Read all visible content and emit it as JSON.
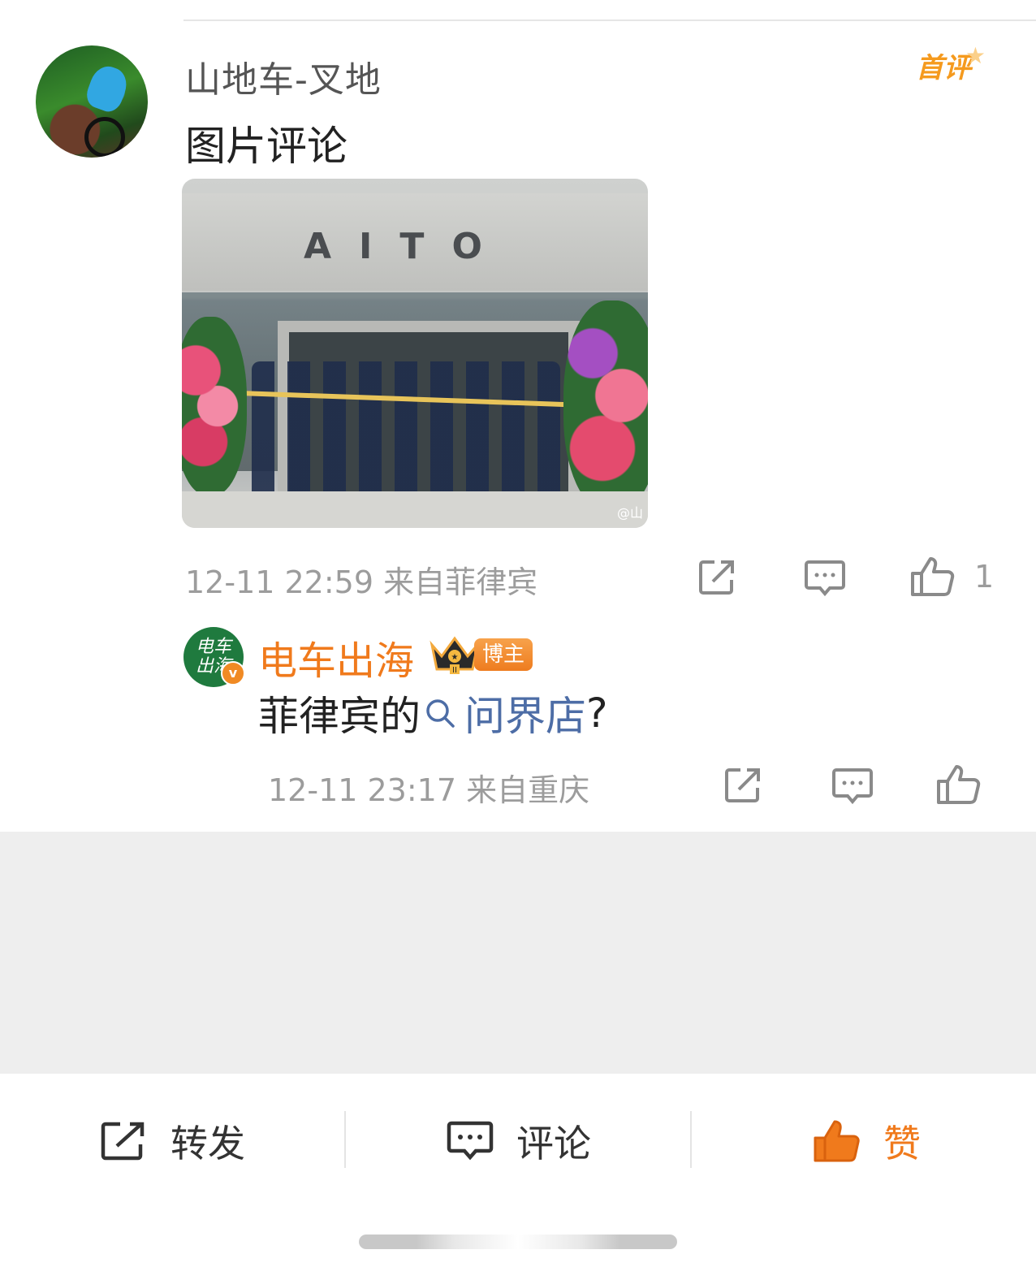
{
  "comment": {
    "username": "山地车-叉地",
    "badge": "首评",
    "text": "图片评论",
    "image": {
      "storefront_brand": "AITO",
      "watermark": "@山"
    },
    "meta": "12-11 22:59 来自菲律宾",
    "like_count": "1"
  },
  "reply": {
    "avatar_text": "电车出海",
    "verified_icon": "v-badge-icon",
    "username": "电车出海",
    "level_badge": "II",
    "role_badge": "博主",
    "text_prefix": "菲律宾的",
    "topic": "问界店",
    "text_suffix": "?",
    "meta": "12-11 23:17 来自重庆"
  },
  "bottom_bar": {
    "repost_label": "转发",
    "comment_label": "评论",
    "like_label": "赞"
  },
  "colors": {
    "accent_orange": "#f07a1c",
    "topic_blue": "#4d6da6",
    "meta_gray": "#9c9c9c"
  }
}
